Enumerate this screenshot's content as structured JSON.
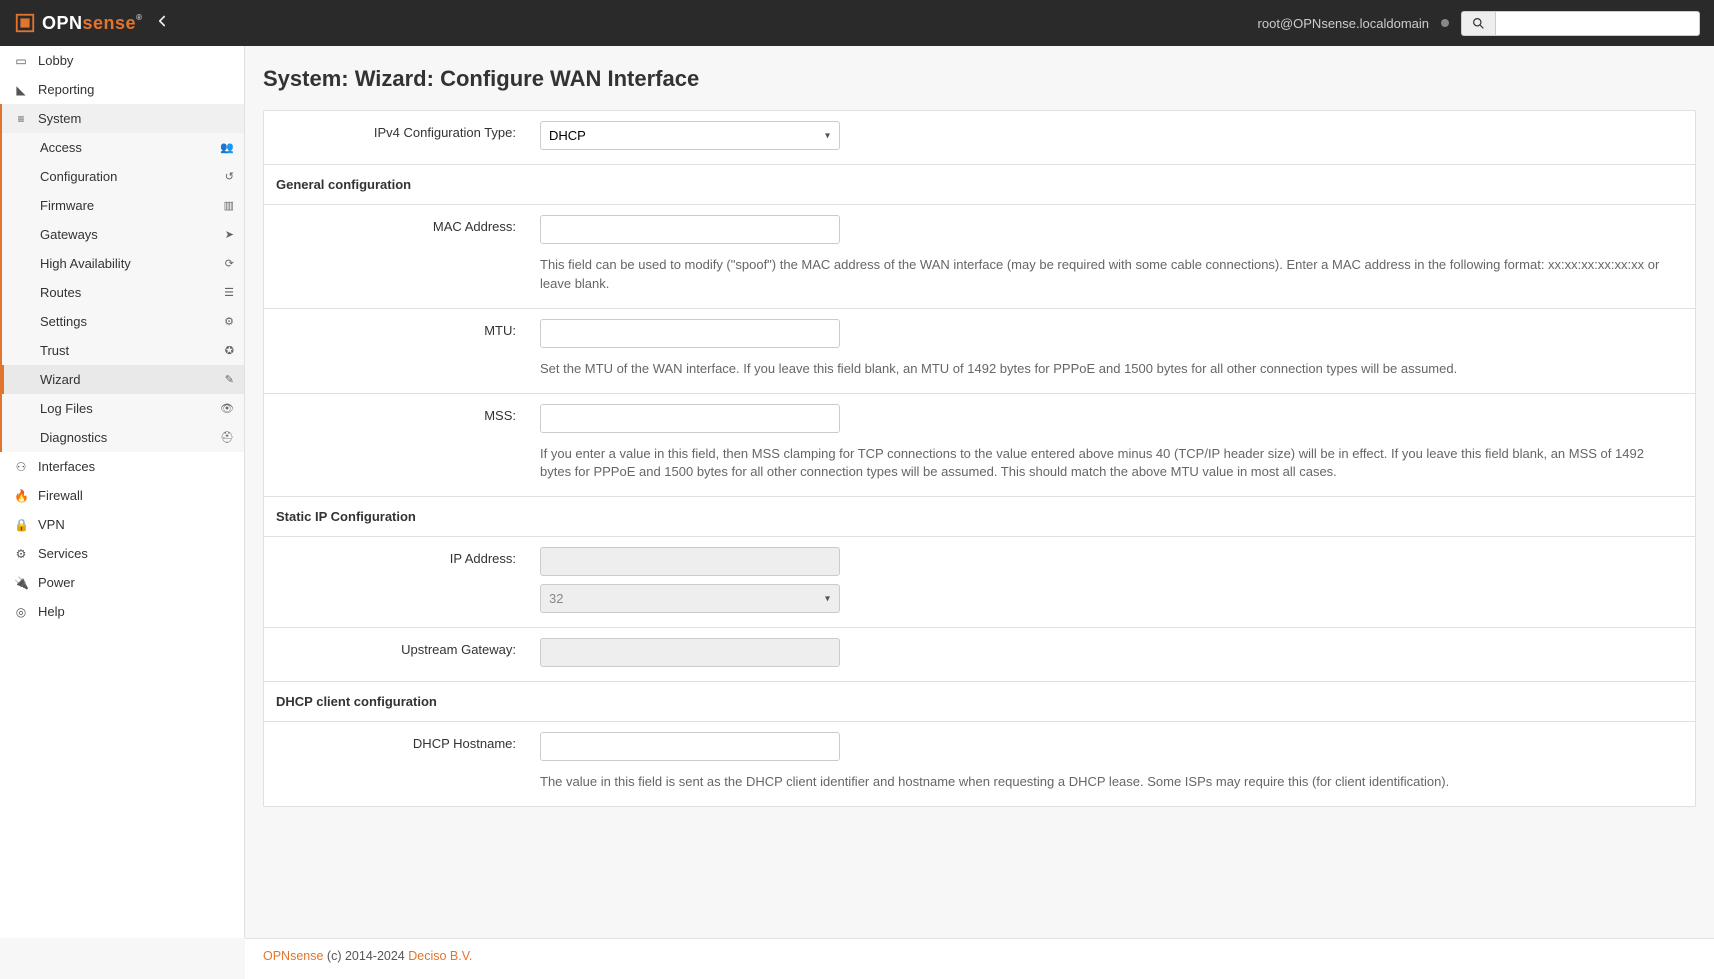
{
  "topnav": {
    "brand_a": "OPN",
    "brand_b": "sense",
    "hostname": "root@OPNsense.localdomain"
  },
  "nav": {
    "lobby": "Lobby",
    "reporting": "Reporting",
    "system": "System",
    "system_items": {
      "access": "Access",
      "configuration": "Configuration",
      "firmware": "Firmware",
      "gateways": "Gateways",
      "ha": "High Availability",
      "routes": "Routes",
      "settings": "Settings",
      "trust": "Trust",
      "wizard": "Wizard",
      "logfiles": "Log Files",
      "diagnostics": "Diagnostics"
    },
    "interfaces": "Interfaces",
    "firewall": "Firewall",
    "vpn": "VPN",
    "services": "Services",
    "power": "Power",
    "help": "Help"
  },
  "page": {
    "title": "System: Wizard: Configure WAN Interface"
  },
  "labels": {
    "ipv4type": "IPv4 Configuration Type:",
    "general": "General configuration",
    "mac": "MAC Address:",
    "mac_help": "This field can be used to modify (\"spoof\") the MAC address of the WAN interface (may be required with some cable connections). Enter a MAC address in the following format: xx:xx:xx:xx:xx:xx or leave blank.",
    "mtu": "MTU:",
    "mtu_help": "Set the MTU of the WAN interface. If you leave this field blank, an MTU of 1492 bytes for PPPoE and 1500 bytes for all other connection types will be assumed.",
    "mss": "MSS:",
    "mss_help": "If you enter a value in this field, then MSS clamping for TCP connections to the value entered above minus 40 (TCP/IP header size) will be in effect. If you leave this field blank, an MSS of 1492 bytes for PPPoE and 1500 bytes for all other connection types will be assumed. This should match the above MTU value in most all cases.",
    "staticip": "Static IP Configuration",
    "ipaddr": "IP Address:",
    "upstream": "Upstream Gateway:",
    "dhcpclient": "DHCP client configuration",
    "dhcphost": "DHCP Hostname:",
    "dhcphost_help": "The value in this field is sent as the DHCP client identifier and hostname when requesting a DHCP lease. Some ISPs may require this (for client identification)."
  },
  "values": {
    "ipv4type": "DHCP",
    "cidr": "32"
  },
  "footer": {
    "brand": "OPNsense",
    "middle": " (c) 2014-2024 ",
    "company": "Deciso B.V."
  }
}
